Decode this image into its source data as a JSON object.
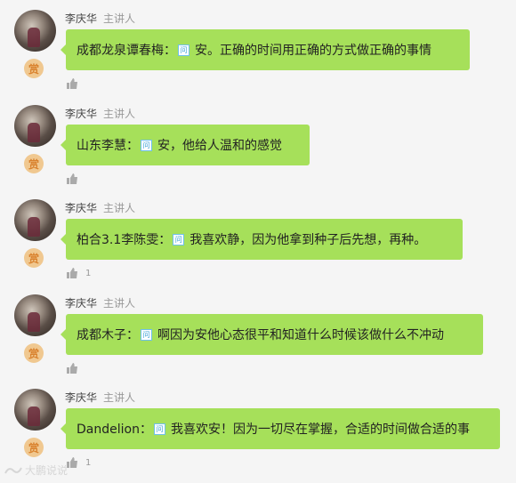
{
  "messages": [
    {
      "name": "李庆华",
      "role": "主讲人",
      "reward": "赏",
      "prefix": "成都龙泉谭春梅：",
      "qicon": "问",
      "text": "安。正确的时间用正确的方式做正确的事情",
      "likes": ""
    },
    {
      "name": "李庆华",
      "role": "主讲人",
      "reward": "赏",
      "prefix": "山东李慧：",
      "qicon": "问",
      "text": "安，他给人温和的感觉",
      "likes": ""
    },
    {
      "name": "李庆华",
      "role": "主讲人",
      "reward": "赏",
      "prefix": "柏合3.1李陈雯：",
      "qicon": "问",
      "text": "我喜欢静，因为他拿到种子后先想，再种。",
      "likes": "1"
    },
    {
      "name": "李庆华",
      "role": "主讲人",
      "reward": "赏",
      "prefix": "成都木子：",
      "qicon": "问",
      "text": "啊因为安他心态很平和知道什么时候该做什么不冲动",
      "likes": ""
    },
    {
      "name": "李庆华",
      "role": "主讲人",
      "reward": "赏",
      "prefix": "Dandelion：",
      "qicon": "问",
      "text": "我喜欢安！因为一切尽在掌握，合适的时间做合适的事",
      "likes": "1"
    }
  ],
  "watermark": "大鹏说说",
  "colors": {
    "bubble": "#a6e05a",
    "reward_bg": "#f0c890",
    "reward_text": "#d9822e",
    "question_icon": "#3a9fd6"
  },
  "icons": {
    "avatar": "avatar",
    "reward": "reward-icon",
    "question": "question-icon",
    "like": "thumbs-up-icon"
  }
}
